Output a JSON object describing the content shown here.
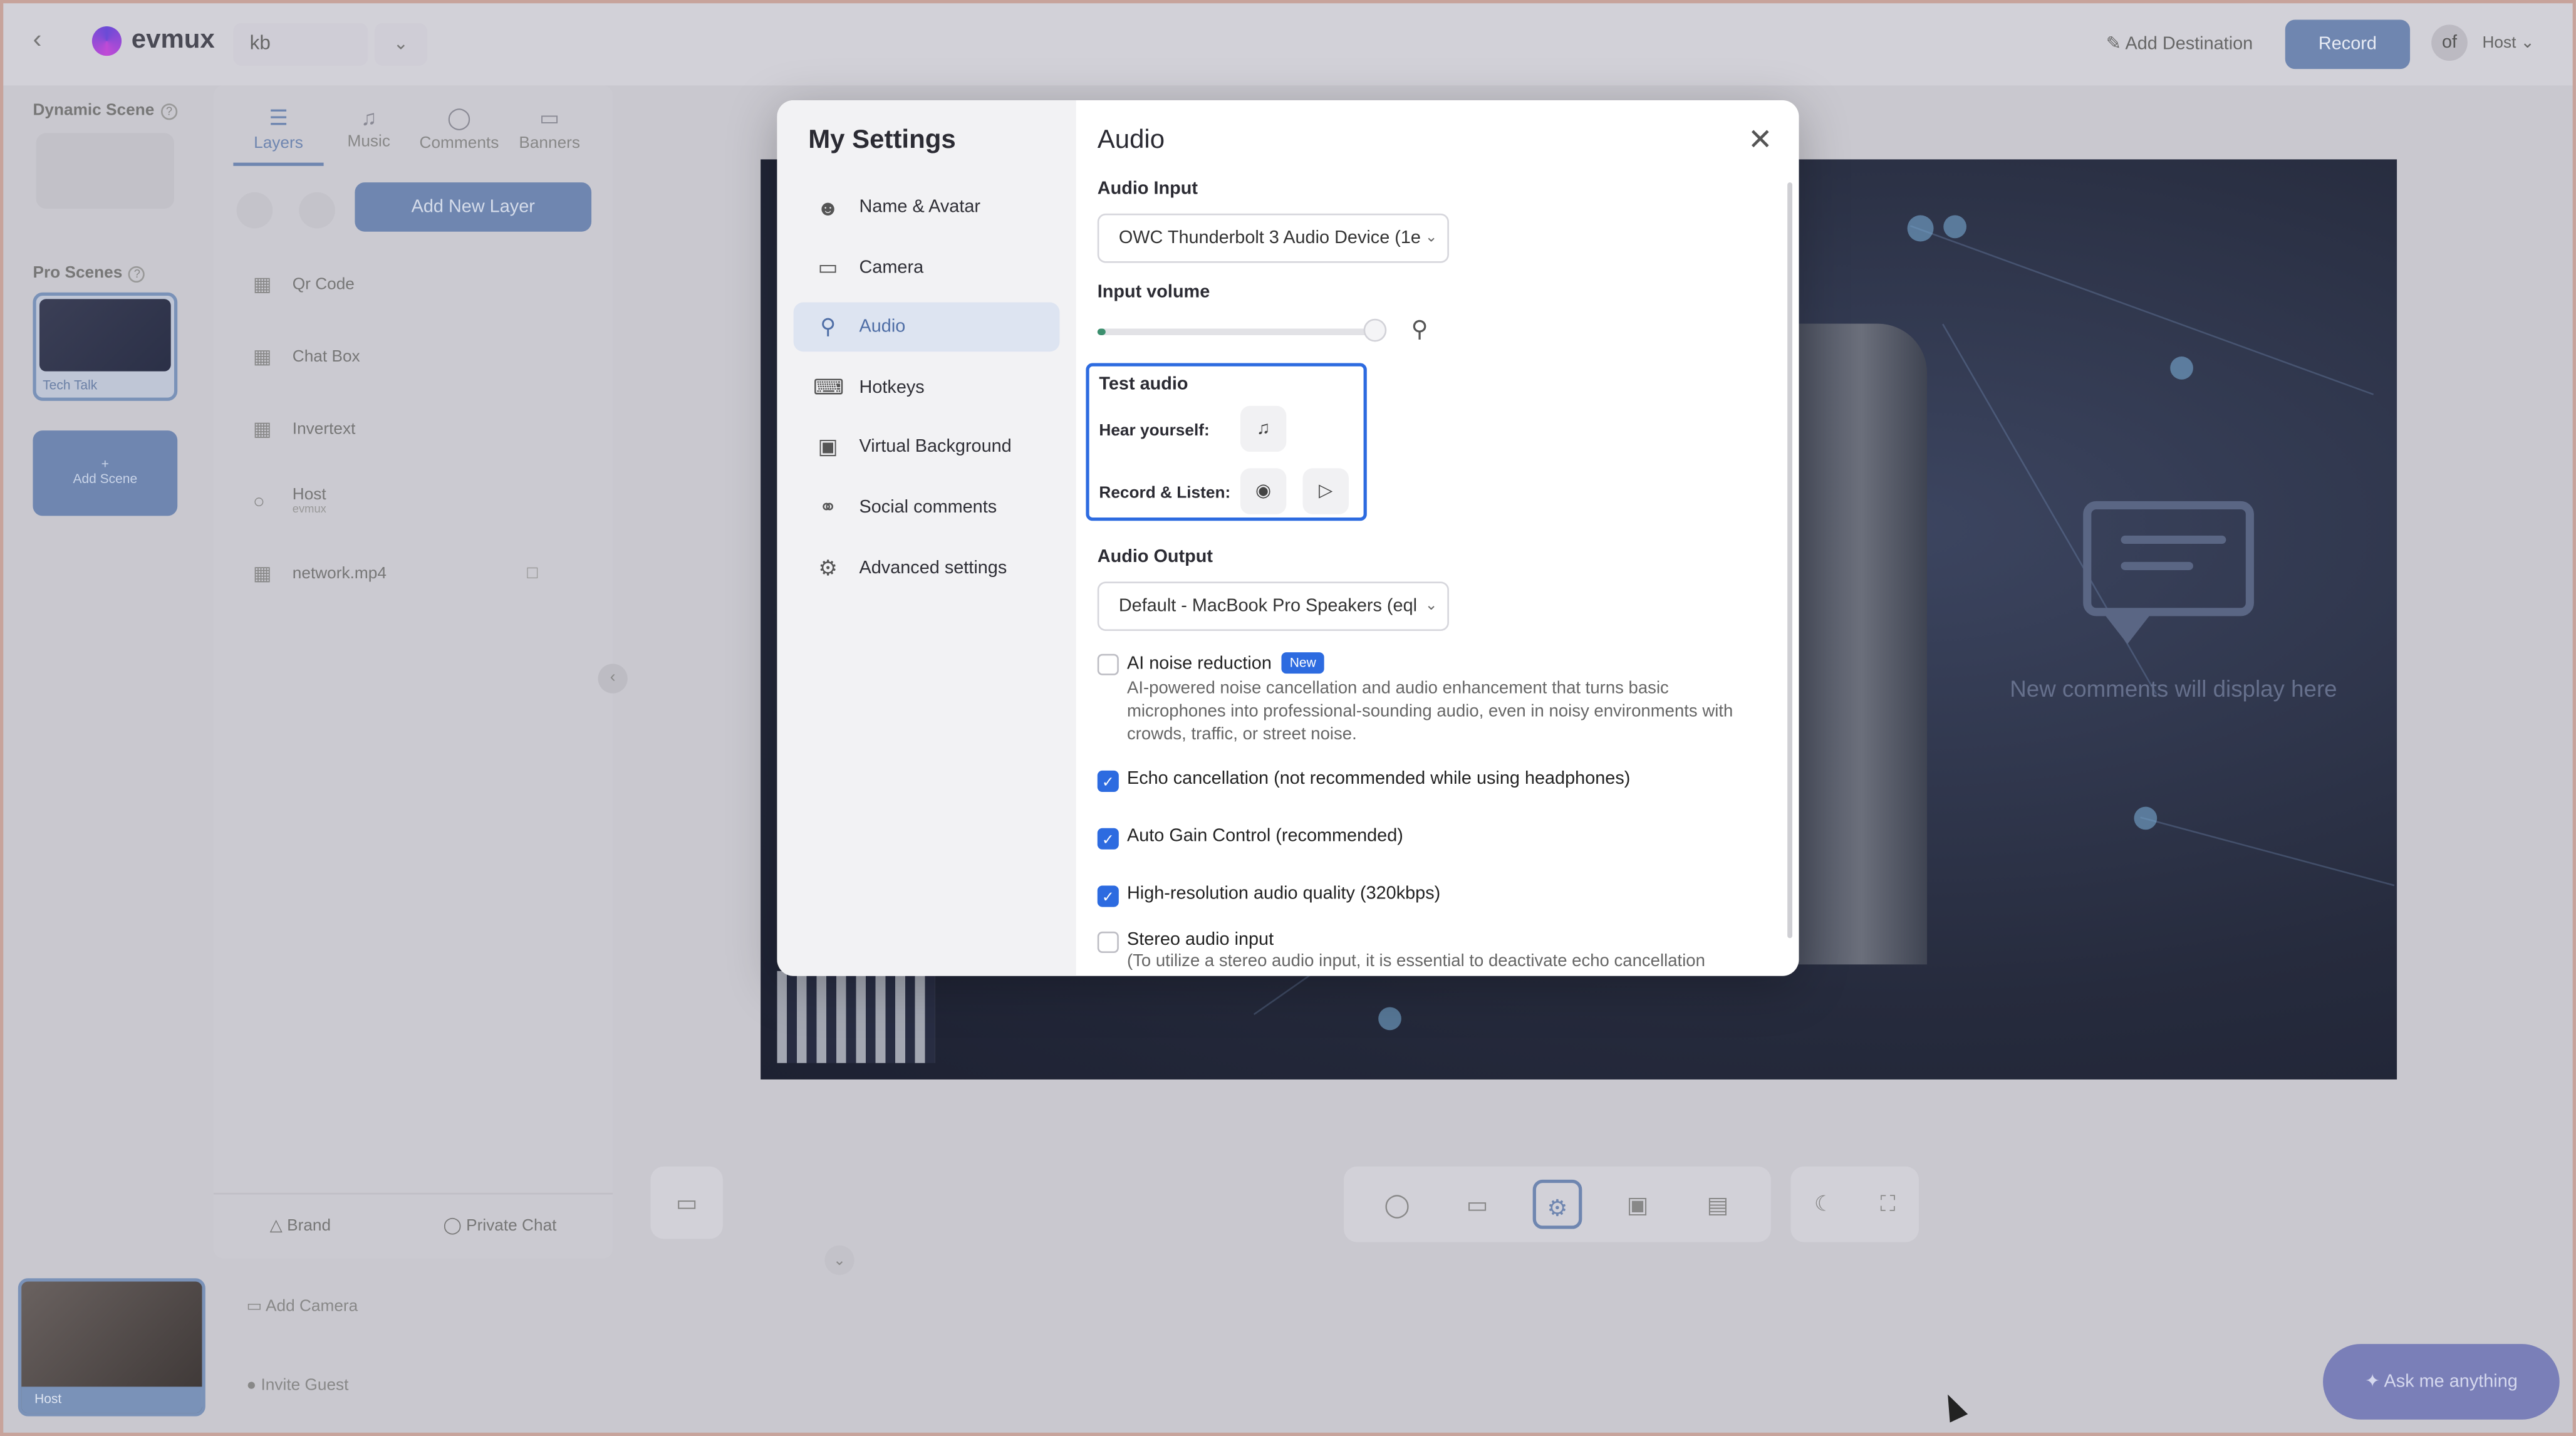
{
  "topbar": {
    "logo": "evmux",
    "studio_name": "kb",
    "add_destination": "Add Destination",
    "record": "Record",
    "user_initials": "of",
    "user_name": "Host"
  },
  "scenes": {
    "dynamic_title": "Dynamic Scene",
    "pro_title": "Pro Scenes",
    "pro_scene_label": "Tech Talk",
    "add_scene": "Add Scene"
  },
  "layers": {
    "tabs": [
      "Layers",
      "Music",
      "Comments",
      "Banners"
    ],
    "add_layer": "Add New Layer",
    "items": [
      {
        "label": "Qr Code",
        "sub": ""
      },
      {
        "label": "Chat Box",
        "sub": ""
      },
      {
        "label": "Invertext",
        "sub": ""
      },
      {
        "label": "Host",
        "sub": "evmux"
      },
      {
        "label": "network.mp4",
        "sub": ""
      }
    ],
    "brand": "Brand",
    "private_chat": "Private Chat"
  },
  "stage": {
    "comments_placeholder": "New comments will display here"
  },
  "bottom": {
    "participant_label": "Host",
    "add_camera": "Add Camera",
    "invite_guest": "Invite Guest",
    "ask": "Ask me anything"
  },
  "modal": {
    "title": "My Settings",
    "section_title": "Audio",
    "nav": [
      {
        "label": "Name & Avatar",
        "icon": "user-icon"
      },
      {
        "label": "Camera",
        "icon": "camera-icon"
      },
      {
        "label": "Audio",
        "icon": "mic-icon"
      },
      {
        "label": "Hotkeys",
        "icon": "keyboard-icon"
      },
      {
        "label": "Virtual Background",
        "icon": "image-icon"
      },
      {
        "label": "Social comments",
        "icon": "social-icon"
      },
      {
        "label": "Advanced settings",
        "icon": "gear-icon"
      }
    ],
    "audio_input_label": "Audio Input",
    "audio_input_value": "OWC Thunderbolt 3 Audio Device (1e",
    "input_volume_label": "Input volume",
    "input_volume_level": 0.98,
    "test_audio_title": "Test audio",
    "hear_yourself": "Hear yourself:",
    "record_listen": "Record & Listen:",
    "audio_output_label": "Audio Output",
    "audio_output_value": "Default - MacBook Pro Speakers (eql",
    "ai_noise_label": "AI noise reduction",
    "ai_noise_badge": "New",
    "ai_noise_desc": "AI-powered noise cancellation and audio enhancement that turns basic microphones into professional-sounding audio, even in noisy environments with crowds, traffic, or street noise.",
    "echo_label": "Echo cancellation (not recommended while using headphones)",
    "agc_label": "Auto Gain Control (recommended)",
    "hires_label": "High-resolution audio quality (320kbps)",
    "stereo_label": "Stereo audio input",
    "stereo_desc": "(To utilize a stereo audio input, it is essential to deactivate echo cancellation"
  },
  "colors": {
    "accent": "#2d6be0",
    "record_button": "#6f86b0",
    "volume_fill": "#3c8f6e"
  }
}
